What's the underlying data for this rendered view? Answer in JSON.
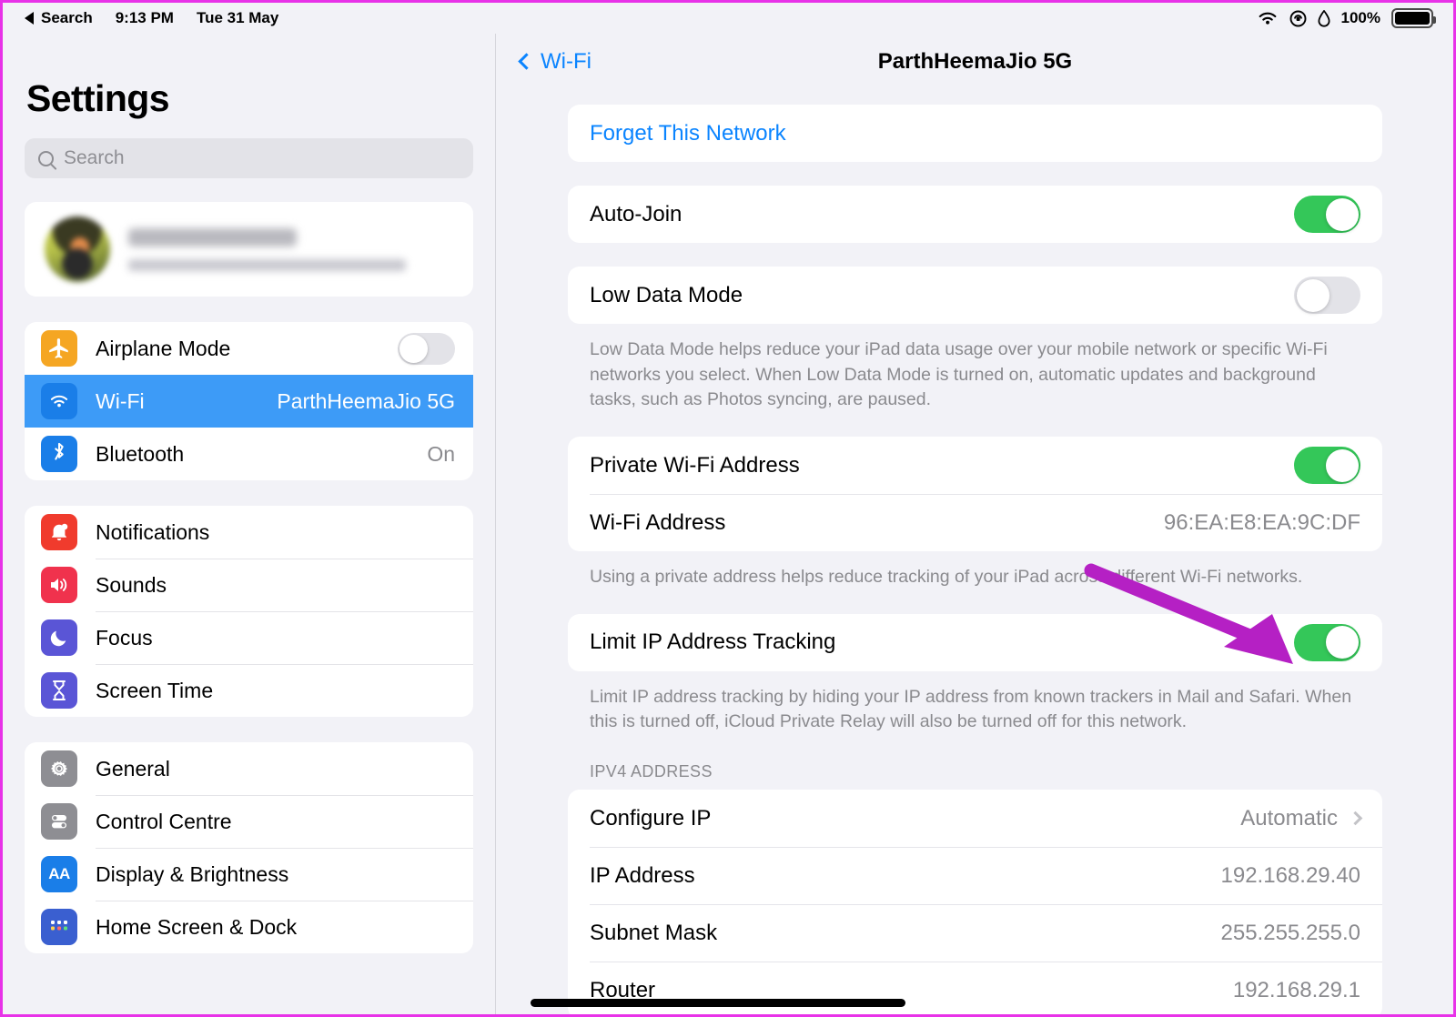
{
  "statusbar": {
    "back_label": "Search",
    "time": "9:13 PM",
    "date": "Tue 31 May",
    "wifi_icon": "wifi-icon",
    "rotation_lock_icon": "rotation-lock-icon",
    "water_drop_icon": "water-drop-icon",
    "battery_percent": "100%"
  },
  "sidebar": {
    "title": "Settings",
    "search_placeholder": "Search",
    "account": {
      "name_redacted": "",
      "subtitle_redacted": ""
    },
    "group1": [
      {
        "label": "Airplane Mode",
        "icon": "airplane-icon",
        "icon_color": "#f5a623",
        "control": "toggle",
        "on": false,
        "selected": false
      },
      {
        "label": "Wi-Fi",
        "icon": "wifi-icon",
        "icon_color": "#1a7ee8",
        "value": "ParthHeemaJio 5G",
        "selected": true
      },
      {
        "label": "Bluetooth",
        "icon": "bluetooth-icon",
        "icon_color": "#1a7ee8",
        "value": "On",
        "selected": false
      }
    ],
    "group2": [
      {
        "label": "Notifications",
        "icon": "bell-icon",
        "icon_color": "#f03b2d"
      },
      {
        "label": "Sounds",
        "icon": "speaker-icon",
        "icon_color": "#f0324d"
      },
      {
        "label": "Focus",
        "icon": "moon-icon",
        "icon_color": "#5a55d6"
      },
      {
        "label": "Screen Time",
        "icon": "hourglass-icon",
        "icon_color": "#5a55d6"
      }
    ],
    "group3": [
      {
        "label": "General",
        "icon": "gear-icon",
        "icon_color": "#8e8e93"
      },
      {
        "label": "Control Centre",
        "icon": "toggles-icon",
        "icon_color": "#8e8e93"
      },
      {
        "label": "Display & Brightness",
        "icon": "text-size-icon",
        "icon_color": "#1a7ee8"
      },
      {
        "label": "Home Screen & Dock",
        "icon": "home-grid-icon",
        "icon_color": "#3a5fd0"
      }
    ]
  },
  "detail": {
    "back_label": "Wi-Fi",
    "title": "ParthHeemaJio 5G",
    "forget_label": "Forget This Network",
    "auto_join": {
      "label": "Auto-Join",
      "on": true
    },
    "low_data": {
      "label": "Low Data Mode",
      "on": false
    },
    "low_data_footnote": "Low Data Mode helps reduce your iPad data usage over your mobile network or specific Wi-Fi networks you select. When Low Data Mode is turned on, automatic updates and background tasks, such as Photos syncing, are paused.",
    "private_wifi": {
      "label": "Private Wi-Fi Address",
      "on": true
    },
    "wifi_address": {
      "label": "Wi-Fi Address",
      "value": "96:EA:E8:EA:9C:DF"
    },
    "private_wifi_footnote": "Using a private address helps reduce tracking of your iPad across different Wi-Fi networks.",
    "limit_ip": {
      "label": "Limit IP Address Tracking",
      "on": true
    },
    "limit_ip_footnote": "Limit IP address tracking by hiding your IP address from known trackers in Mail and Safari. When this is turned off, iCloud Private Relay will also be turned off for this network.",
    "ipv4_header": "IPV4 ADDRESS",
    "ipv4_rows": [
      {
        "label": "Configure IP",
        "value": "Automatic",
        "chevron": true
      },
      {
        "label": "IP Address",
        "value": "192.168.29.40",
        "chevron": false
      },
      {
        "label": "Subnet Mask",
        "value": "255.255.255.0",
        "chevron": false
      },
      {
        "label": "Router",
        "value": "192.168.29.1",
        "chevron": false
      }
    ]
  },
  "annotation": {
    "arrow_color": "#b520c4",
    "points_to": "Limit IP Address Tracking toggle"
  },
  "colors": {
    "accent_blue": "#0a84ff",
    "toggle_green": "#34c759",
    "selected_blue": "#3d9bf7",
    "border_magenta": "#e832e8"
  }
}
